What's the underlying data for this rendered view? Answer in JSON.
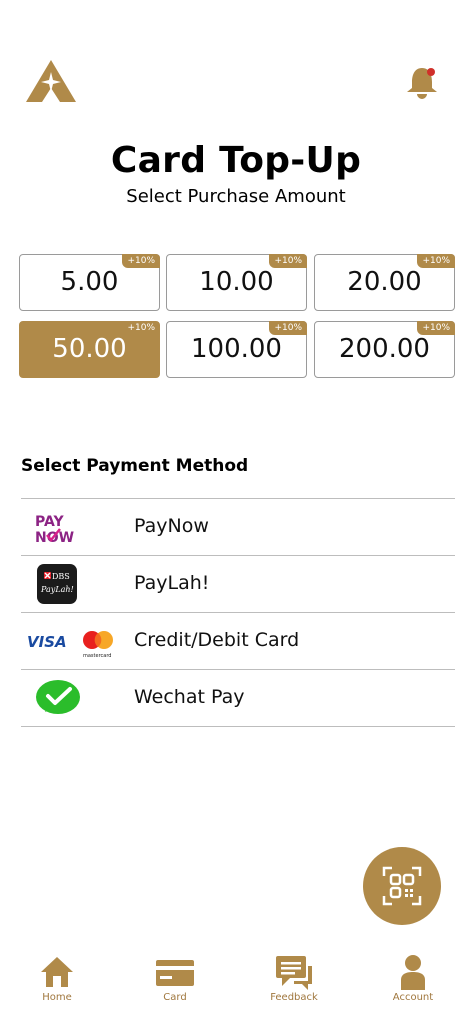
{
  "header": {
    "logo_icon": "brand-a-logo-icon",
    "bell_icon": "notification-bell-icon",
    "brand_color": "#b08a49",
    "alert_dot_color": "#d0302a"
  },
  "title": "Card Top-Up",
  "subtitle": "Select Purchase Amount",
  "amounts": [
    {
      "value": "5.00",
      "bonus": "+10%",
      "selected": false
    },
    {
      "value": "10.00",
      "bonus": "+10%",
      "selected": false
    },
    {
      "value": "20.00",
      "bonus": "+10%",
      "selected": false
    },
    {
      "value": "50.00",
      "bonus": "+10%",
      "selected": true
    },
    {
      "value": "100.00",
      "bonus": "+10%",
      "selected": false
    },
    {
      "value": "200.00",
      "bonus": "+10%",
      "selected": false
    }
  ],
  "payment": {
    "title": "Select Payment Method",
    "methods": [
      {
        "label": "PayNow",
        "icon": "paynow-logo-icon",
        "logo_text": [
          "PAY",
          "NOW"
        ]
      },
      {
        "label": "PayLah!",
        "icon": "dbs-paylah-logo-icon",
        "logo_text": [
          "DBS",
          "PayLah!"
        ]
      },
      {
        "label": "Credit/Debit Card",
        "icon": "visa-mastercard-logo-icon",
        "logo_text": [
          "VISA",
          "mastercard"
        ]
      },
      {
        "label": "Wechat Pay",
        "icon": "wechat-pay-logo-icon"
      }
    ]
  },
  "fab": {
    "icon": "qr-scan-icon"
  },
  "nav": [
    {
      "label": "Home",
      "icon": "home-icon"
    },
    {
      "label": "Card",
      "icon": "card-icon"
    },
    {
      "label": "Feedback",
      "icon": "feedback-icon"
    },
    {
      "label": "Account",
      "icon": "account-icon"
    }
  ]
}
